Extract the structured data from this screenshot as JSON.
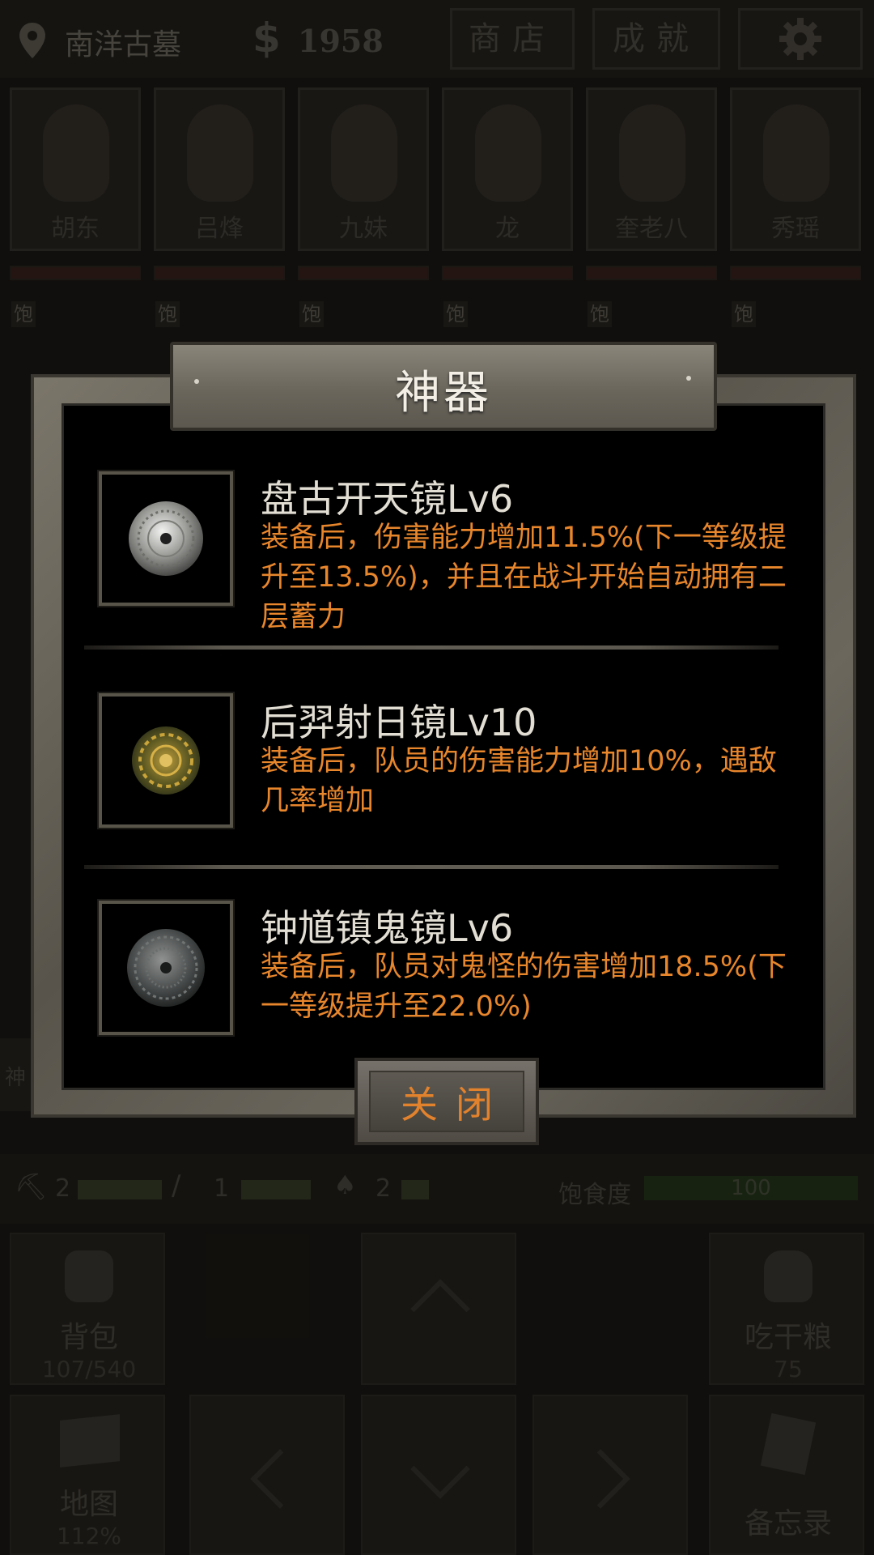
{
  "topbar": {
    "location": "南洋古墓",
    "money_symbol": "$",
    "money": "1958",
    "shop_label": "商店",
    "achievements_label": "成就"
  },
  "party": [
    {
      "name": "胡东",
      "status": "饱"
    },
    {
      "name": "吕烽",
      "status": "饱"
    },
    {
      "name": "九妹",
      "status": "饱"
    },
    {
      "name": "龙",
      "status": "饱"
    },
    {
      "name": "奎老八",
      "status": "饱"
    },
    {
      "name": "秀瑶",
      "status": "饱"
    }
  ],
  "tools": {
    "axe_count": "2",
    "rope_count": "1",
    "shovel_count": "2",
    "satiety_label": "饱食度",
    "satiety_value": "100"
  },
  "grid": {
    "backpack_label": "背包",
    "backpack_sub": "107/540",
    "eat_label": "吃干粮",
    "eat_sub": "75",
    "map_label": "地图",
    "map_sub": "112%",
    "memo_label": "备忘录",
    "side_tab": "神"
  },
  "modal": {
    "title": "神器",
    "items": [
      {
        "name": "盘古开天镜Lv6",
        "desc": "装备后，伤害能力增加11.5%(下一等级提升至13.5%)，并且在战斗开始自动拥有二层蓄力",
        "icon": "silver-mirror-icon"
      },
      {
        "name": "后羿射日镜Lv10",
        "desc": "装备后，队员的伤害能力增加10%，遇敌几率增加",
        "icon": "golden-mirror-icon"
      },
      {
        "name": "钟馗镇鬼镜Lv6",
        "desc": "装备后，队员对鬼怪的伤害增加18.5%(下一等级提升至22.0%)",
        "icon": "dark-mirror-icon"
      }
    ],
    "close_label": "关闭"
  },
  "colors": {
    "accent_orange": "#e8862c",
    "item_name": "#e2ded4",
    "modal_bg": "#000000"
  }
}
